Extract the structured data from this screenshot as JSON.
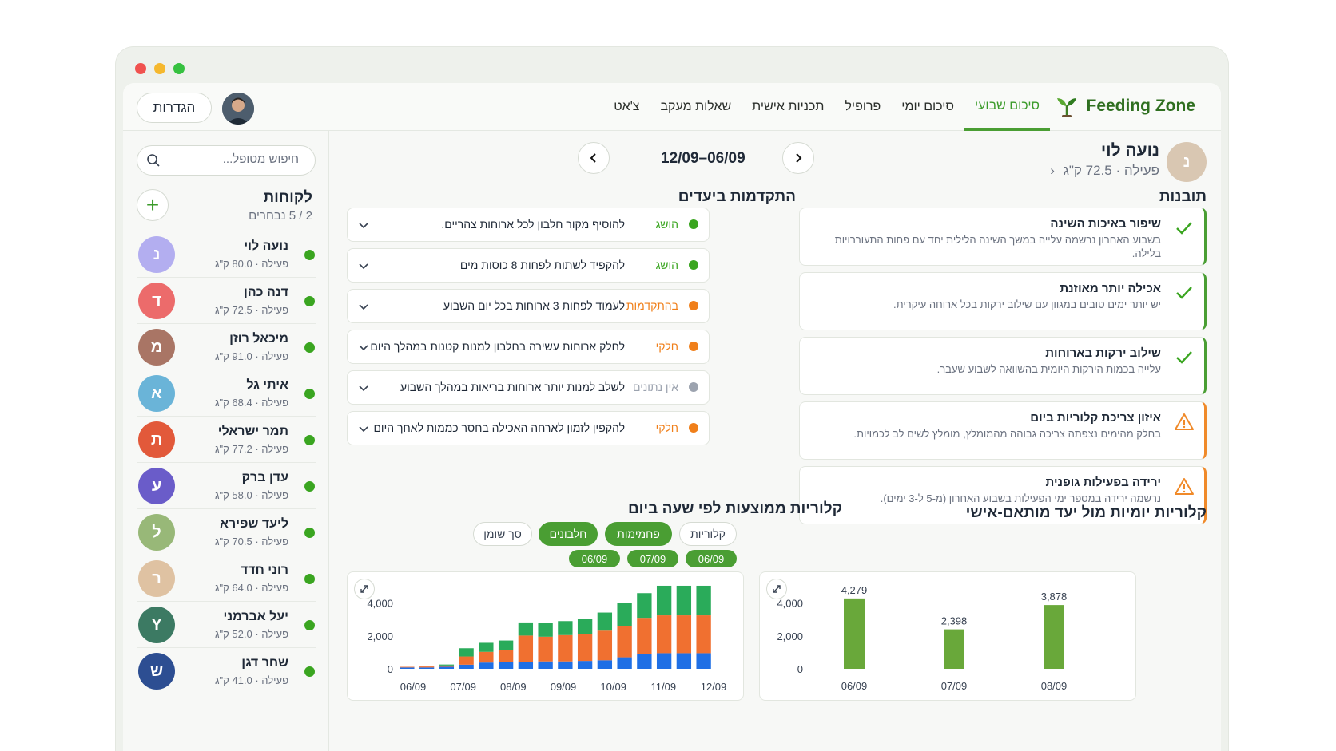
{
  "brand": {
    "name": "Feeding Zone"
  },
  "nav": [
    {
      "label": "סיכום שבועי",
      "active": true
    },
    {
      "label": "סיכום יומי",
      "active": false
    },
    {
      "label": "פרופיל",
      "active": false
    },
    {
      "label": "תכניות אישית",
      "active": false
    },
    {
      "label": "שאלות מעקב",
      "active": false
    },
    {
      "label": "צ'אט",
      "active": false
    }
  ],
  "header": {
    "settings_label": "הגדרות"
  },
  "sidebar": {
    "search_placeholder": "חיפוש מטופל...",
    "title": "לקוחות",
    "count": "2 / 5 נבחרים",
    "clients": [
      {
        "initial": "נ",
        "name": "נועה לוי",
        "meta": "פעילה · 80.0 ק\"ג",
        "color": "#b3aef0"
      },
      {
        "initial": "ד",
        "name": "דנה כהן",
        "meta": "פעילה · 72.5 ק\"ג",
        "color": "#ec6b6b"
      },
      {
        "initial": "מ",
        "name": "מיכאל רוזן",
        "meta": "פעילה · 91.0 ק\"ג",
        "color": "#a97565"
      },
      {
        "initial": "א",
        "name": "איתי גל",
        "meta": "פעילה · 68.4 ק\"ג",
        "color": "#6ab4d8"
      },
      {
        "initial": "ת",
        "name": "תמר ישראלי",
        "meta": "פעילה · 77.2 ק\"ג",
        "color": "#e2593a"
      },
      {
        "initial": "ע",
        "name": "עדן ברק",
        "meta": "פעילה · 58.0 ק\"ג",
        "color": "#6a5cc9"
      },
      {
        "initial": "ל",
        "name": "ליעד שפירא",
        "meta": "פעילה · 70.5 ק\"ג",
        "color": "#98b878"
      },
      {
        "initial": "ר",
        "name": "רוני חדד",
        "meta": "פעילה · 64.0 ק\"ג",
        "color": "#dfc2a2"
      },
      {
        "initial": "Y",
        "name": "יעל אברמני",
        "meta": "פעילה · 52.0 ק\"ג",
        "color": "#3c7a63"
      },
      {
        "initial": "ש",
        "name": "שחר דגן",
        "meta": "פעילה · 41.0 ק\"ג",
        "color": "#2d4e92"
      }
    ]
  },
  "profile": {
    "initial": "נ",
    "name": "נועה לוי",
    "meta": "פעילה · 72.5 ק\"ג"
  },
  "date_range": "12/09–06/09",
  "insights_title": "תובנות",
  "insights": [
    {
      "type": "ok",
      "title": "שיפור באיכות השינה",
      "desc": "בשבוע האחרון נרשמה עלייה במשך השינה הלילית יחד עם פחות התעוררויות בלילה."
    },
    {
      "type": "ok",
      "title": "אכילה יותר מאוזנת",
      "desc": "יש יותר ימים טובים במגוון עם שילוב ירקות בכל ארוחה עיקרית."
    },
    {
      "type": "ok",
      "title": "שילוב ירקות בארוחות",
      "desc": "עלייה בכמות הירקות היומית בהשוואה לשבוע שעבר."
    },
    {
      "type": "warn",
      "title": "איזון צריכת קלוריות ביום",
      "desc": "בחלק מהימים נצפתה צריכה גבוהה מהמומלץ, מומלץ לשים לב לכמויות."
    },
    {
      "type": "warn",
      "title": "ירידה בפעילות גופנית",
      "desc": "נרשמה ירידה במספר ימי הפעילות בשבוע האחרון (מ-5 ל-3 ימים)."
    }
  ],
  "goals_title": "התקדמות ביעדים",
  "goals": [
    {
      "status": "הושג",
      "status_color": "#3aa520",
      "text": "להוסיף מקור חלבון לכל ארוחות צהריים."
    },
    {
      "status": "הושג",
      "status_color": "#3aa520",
      "text": "להקפיד לשתות לפחות 8 כוסות מים"
    },
    {
      "status": "בהתקדמות",
      "status_color": "#f07f1a",
      "text": "לעמוד לפחות 3 ארוחות בכל יום השבוע"
    },
    {
      "status": "חלקי",
      "status_color": "#f07f1a",
      "text": "לחלק ארוחות עשירה בחלבון למנות קטנות במהלך היום"
    },
    {
      "status": "אין נתונים",
      "status_color": "#9ca3af",
      "text": "לשלב למנות יותר ארוחות בריאות במהלך השבוע"
    },
    {
      "status": "חלקי",
      "status_color": "#f07f1a",
      "text": "להקפין לזמון לארחה האכילה בחסר כממות לאחך היום"
    }
  ],
  "hourly_chart": {
    "title": "קלוריות ממוצעות לפי שעה ביום",
    "filters": [
      {
        "label": "קלוריות",
        "on": false
      },
      {
        "label": "פחמימות",
        "on": true
      },
      {
        "label": "חלבונים",
        "on": true
      },
      {
        "label": "סך שומן",
        "on": false
      }
    ],
    "dates": [
      "06/09",
      "07/09",
      "06/09"
    ]
  },
  "daily_chart": {
    "title": "קלוריות יומיות מול יעד מותאם-אישי"
  },
  "chart_data": [
    {
      "type": "bar",
      "title": "קלוריות ממוצעות לפי שעה ביום",
      "stacked": true,
      "x_tick_labels": [
        "06/09",
        "07/09",
        "08/09",
        "09/09",
        "10/09",
        "11/09",
        "12/09"
      ],
      "ylim": [
        0,
        5000
      ],
      "y_ticks": [
        0,
        2000,
        4000
      ],
      "series": [
        {
          "color": "#1f6fe5",
          "values": [
            80,
            80,
            120,
            250,
            380,
            420,
            420,
            450,
            450,
            480,
            520,
            700,
            900,
            950,
            950,
            950
          ]
        },
        {
          "color": "#f07030",
          "values": [
            40,
            60,
            80,
            500,
            650,
            700,
            1600,
            1500,
            1600,
            1650,
            1800,
            1900,
            2200,
            2300,
            2300,
            2300
          ]
        },
        {
          "color": "#2aab5a",
          "values": [
            0,
            0,
            60,
            500,
            550,
            600,
            800,
            850,
            850,
            900,
            1100,
            1400,
            1500,
            1800,
            1800,
            1800
          ]
        }
      ]
    },
    {
      "type": "bar",
      "title": "קלוריות יומיות מול יעד מותאם-אישי",
      "categories": [
        "06/09",
        "07/09",
        "08/09"
      ],
      "values": [
        4279,
        2398,
        3878
      ],
      "value_labels": [
        "4,279",
        "2,398",
        "3,878"
      ],
      "ylim": [
        0,
        5000
      ],
      "y_ticks": [
        0,
        2000,
        4000
      ],
      "color": "#69a83a"
    }
  ]
}
